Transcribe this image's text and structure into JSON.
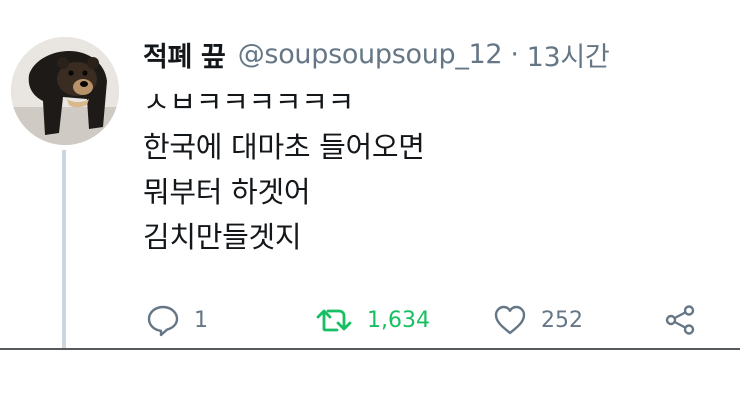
{
  "tweet": {
    "display_name": "적폐 끞",
    "handle": "@soupsoupsoup_12",
    "separator": "·",
    "timestamp": "13시간",
    "lines": [
      "ㅅㅂㅋㅋㅋㅋㅋㅋ",
      "한국에 대마초 들어오면",
      "뭐부터 하겟어",
      "김치만들겟지"
    ],
    "actions": {
      "reply_count": "1",
      "retweet_count": "1,634",
      "like_count": "252"
    },
    "colors": {
      "retweet_active": "#17bf63",
      "muted": "#657786",
      "thread_line": "#ccd6dd"
    },
    "icons": {
      "avatar": "sun-bear-photo",
      "reply": "reply-bubble-icon",
      "retweet": "retweet-icon",
      "like": "heart-icon",
      "share": "share-icon"
    }
  }
}
